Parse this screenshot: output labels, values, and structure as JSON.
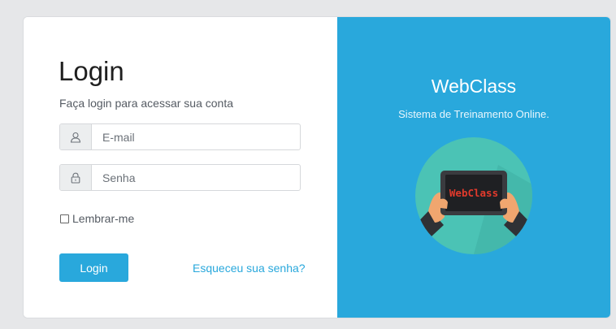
{
  "login_form": {
    "title": "Login",
    "subtitle": "Faça login para acessar sua conta",
    "email_placeholder": "E-mail",
    "password_placeholder": "Senha",
    "remember_label": "Lembrar-me",
    "remember_checked": false,
    "submit_label": "Login",
    "forgot_label": "Esqueceu sua senha?",
    "icons": {
      "email": "user-icon",
      "password": "lock-icon"
    }
  },
  "brand": {
    "name": "WebClass",
    "tagline": "Sistema de Treinamento Online.",
    "tablet_label": "WebClass"
  },
  "colors": {
    "background": "#e6e7e9",
    "accent": "#29a8dc",
    "card": "#ffffff",
    "illustration_circle": "#4bc3b5",
    "tablet_screen": "#222326",
    "tablet_text": "#e23a2c"
  }
}
